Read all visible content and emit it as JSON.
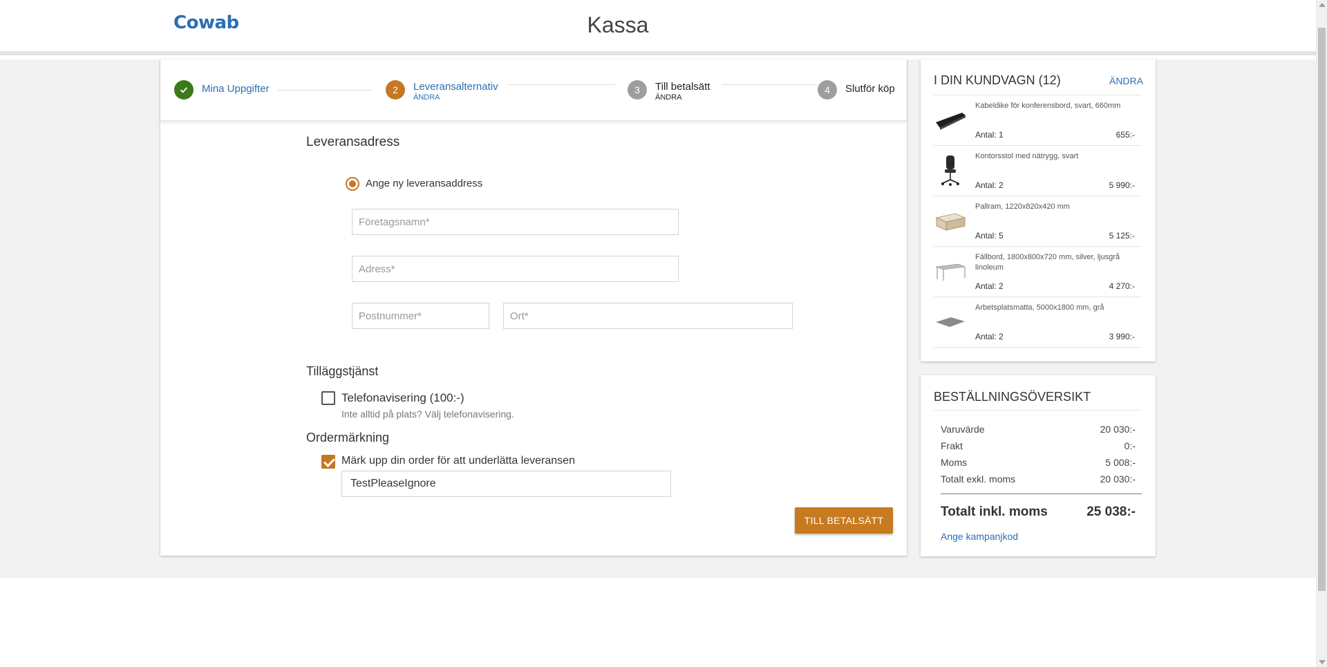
{
  "header": {
    "logo": "Cowab",
    "title": "Kassa"
  },
  "colors": {
    "accent": "#c47822",
    "link": "#2a6fb4",
    "done": "#3b7a16",
    "inactive": "#9e9e9e"
  },
  "steps": [
    {
      "label": "Mina Uppgifter",
      "sub": "",
      "state": "done",
      "icon": "check-icon"
    },
    {
      "number": "2",
      "label": "Leveransalternativ",
      "sub": "ÄNDRA",
      "state": "active"
    },
    {
      "number": "3",
      "label": "Till betalsätt",
      "sub": "ÄNDRA",
      "state": "upcoming"
    },
    {
      "number": "4",
      "label": "Slutför köp",
      "sub": "",
      "state": "upcoming"
    }
  ],
  "delivery": {
    "title": "Leveransadress",
    "radio_label": "Ange ny leveransaddress",
    "company_placeholder": "Företagsnamn*",
    "address_placeholder": "Adress*",
    "zip_placeholder": "Postnummer*",
    "city_placeholder": "Ort*"
  },
  "addon": {
    "title": "Tilläggstjänst",
    "phone_label": "Telefonavisering (100:-)",
    "phone_hint": "Inte alltid på plats? Välj telefonavisering.",
    "phone_checked": false
  },
  "marking": {
    "title": "Ordermärkning",
    "label": "Märk upp din order för att underlätta leveransen",
    "checked": true,
    "value": "TestPleaseIgnore"
  },
  "cta_label": "Till betalsätt",
  "cart": {
    "title": "I DIN KUNDVAGN (12)",
    "change_label": "Ändra",
    "items": [
      {
        "name": "Kabeldike för konferensbord, svart, 660mm",
        "qty": "Antal: 1",
        "price": "655:-",
        "icon": "cable-tray-icon"
      },
      {
        "name": "Kontorsstol med nätrygg, svart",
        "qty": "Antal: 2",
        "price": "5 990:-",
        "icon": "office-chair-icon"
      },
      {
        "name": "Pallram, 1220x820x420 mm",
        "qty": "Antal: 5",
        "price": "5 125:-",
        "icon": "pallet-frame-icon"
      },
      {
        "name": "Fällbord, 1800x800x720 mm, silver, ljusgrå linoleum",
        "qty": "Antal: 2",
        "price": "4 270:-",
        "icon": "folding-table-icon"
      },
      {
        "name": "Arbetsplatsmatta, 5000x1800 mm, grå",
        "qty": "Antal: 2",
        "price": "3 990:-",
        "icon": "floor-mat-icon"
      }
    ]
  },
  "summary": {
    "title": "Beställningsöversikt",
    "rows": [
      {
        "label": "Varuvärde",
        "value": "20 030:-"
      },
      {
        "label": "Frakt",
        "value": "0:-"
      },
      {
        "label": "Moms",
        "value": "5 008:-"
      },
      {
        "label": "Totalt exkl. moms",
        "value": "20 030:-"
      }
    ],
    "total_label": "Totalt inkl. moms",
    "total_value": "25 038:-",
    "promo_label": "Ange kampanjkod"
  }
}
